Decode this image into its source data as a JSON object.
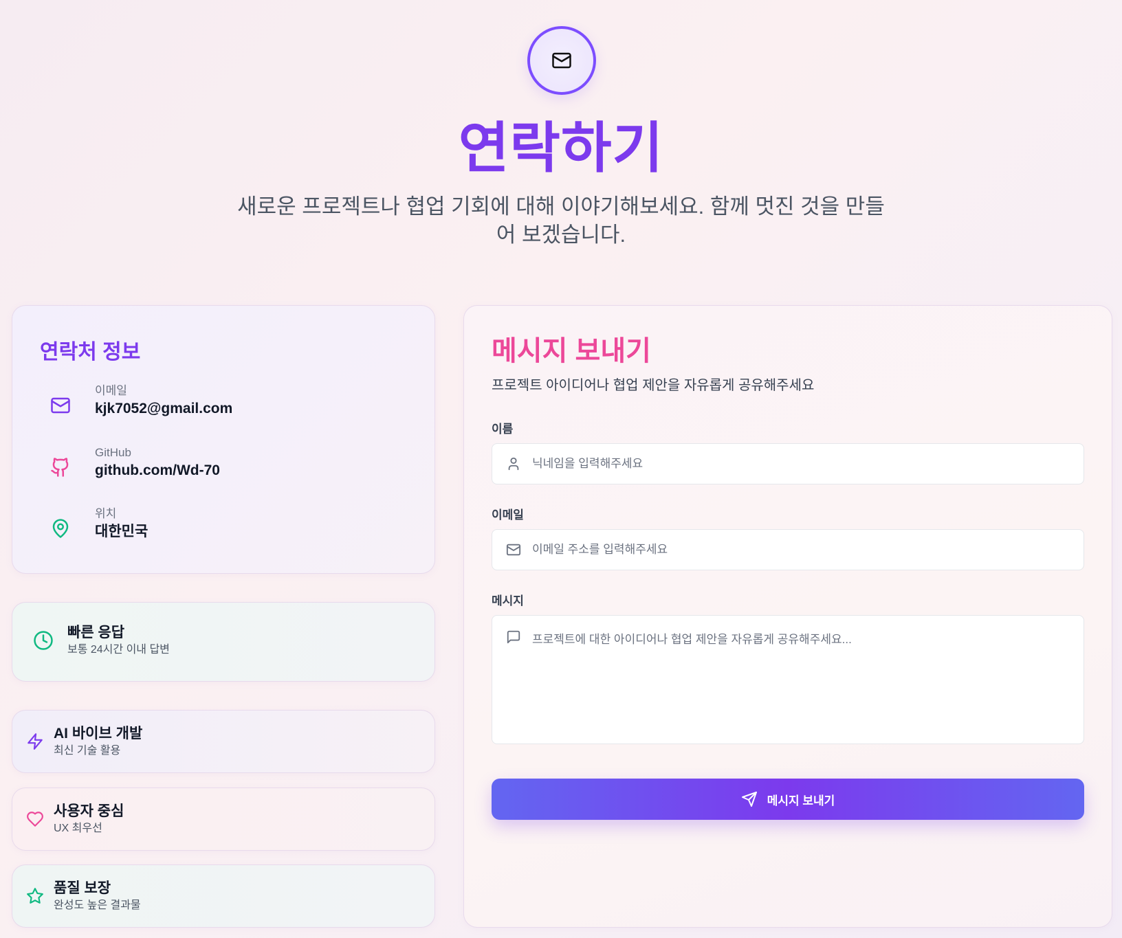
{
  "hero": {
    "icon": "mail-icon",
    "title": "연락하기",
    "subtitle": "새로운 프로젝트나 협업 기회에 대해 이야기해보세요. 함께 멋진 것을 만들어 보겠습니다."
  },
  "contact": {
    "title": "연락처 정보",
    "items": [
      {
        "icon": "mail-icon",
        "label": "이메일",
        "value": "kjk7052@gmail.com",
        "color": "#7c3aed"
      },
      {
        "icon": "github-icon",
        "label": "GitHub",
        "value": "github.com/Wd-70",
        "color": "#ec4899"
      },
      {
        "icon": "map-pin-icon",
        "label": "위치",
        "value": "대한민국",
        "color": "#10b981"
      }
    ]
  },
  "features": [
    {
      "icon": "clock-icon",
      "title": "빠른 응답",
      "desc": "보통 24시간 이내 답변",
      "color": "#10b981"
    },
    {
      "icon": "zap-icon",
      "title": "AI 바이브 개발",
      "desc": "최신 기술 활용",
      "color": "#7c3aed"
    },
    {
      "icon": "heart-icon",
      "title": "사용자 중심",
      "desc": "UX 최우선",
      "color": "#ec4899"
    },
    {
      "icon": "star-icon",
      "title": "품질 보장",
      "desc": "완성도 높은 결과물",
      "color": "#10b981"
    }
  ],
  "form": {
    "title": "메시지 보내기",
    "subtitle": "프로젝트 아이디어나 협업 제안을 자유롭게 공유해주세요",
    "name": {
      "label": "이름",
      "placeholder": "닉네임을 입력해주세요",
      "value": ""
    },
    "email": {
      "label": "이메일",
      "placeholder": "이메일 주소를 입력해주세요",
      "value": ""
    },
    "message": {
      "label": "메시지",
      "placeholder": "프로젝트에 대한 아이디어나 협업 제안을 자유롭게 공유해주세요...",
      "value": ""
    },
    "submit_label": "메시지 보내기"
  },
  "colors": {
    "accent_purple": "#7c3aed",
    "accent_pink": "#ec4899",
    "accent_green": "#10b981",
    "button_gradient": [
      "#6366f1",
      "#7c3aed"
    ]
  }
}
